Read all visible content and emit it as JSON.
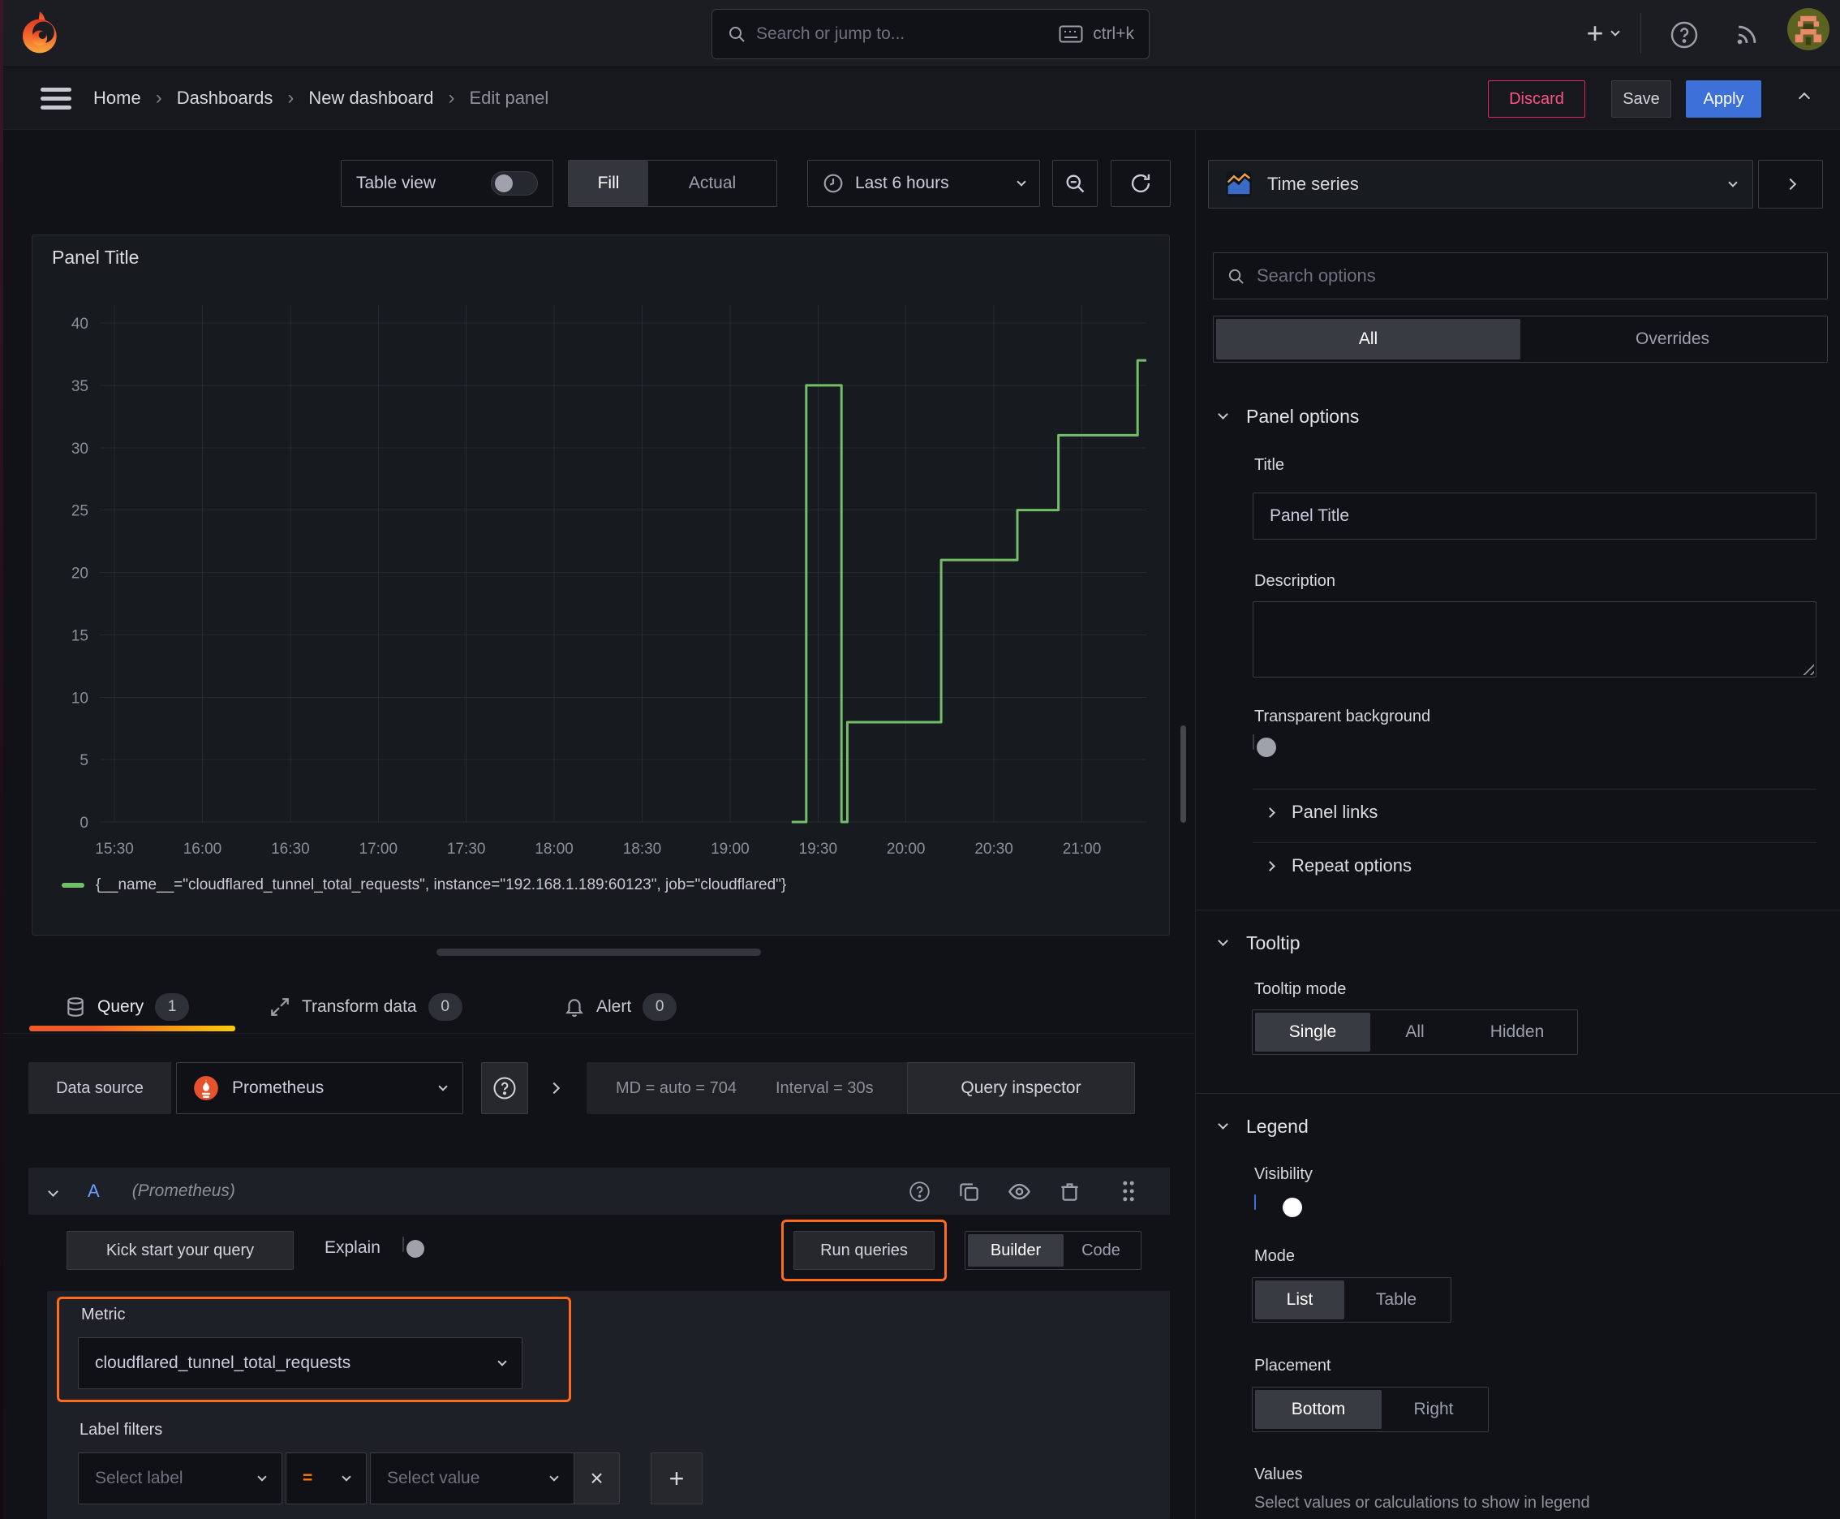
{
  "colors": {
    "accent_orange": "#ff6b18",
    "series_green": "#73bf69",
    "primary_blue": "#3d71d9",
    "danger_pink": "#ff5286"
  },
  "topbar": {
    "search_placeholder": "Search or jump to...",
    "shortcut": "ctrl+k"
  },
  "breadcrumb": {
    "items": [
      "Home",
      "Dashboards",
      "New dashboard",
      "Edit panel"
    ]
  },
  "actions": {
    "discard": "Discard",
    "save": "Save",
    "apply": "Apply"
  },
  "toolbar": {
    "table_view_label": "Table view",
    "fill": "Fill",
    "actual": "Actual",
    "time_range": "Last 6 hours"
  },
  "viz_picker": {
    "name": "Time series"
  },
  "panel": {
    "title": "Panel Title",
    "legend": "{__name__=\"cloudflared_tunnel_total_requests\", instance=\"192.168.1.189:60123\", job=\"cloudflared\"}"
  },
  "chart_data": {
    "type": "line",
    "title": "Panel Title",
    "line_interpolation": "step-after",
    "grid": true,
    "legend_position": "bottom",
    "x_domain": [
      "15:25",
      "21:22"
    ],
    "x_ticks": [
      "15:30",
      "16:00",
      "16:30",
      "17:00",
      "17:30",
      "18:00",
      "18:30",
      "19:00",
      "19:30",
      "20:00",
      "20:30",
      "21:00"
    ],
    "y_ticks": [
      0,
      5,
      10,
      15,
      20,
      25,
      30,
      35,
      40
    ],
    "ylim": [
      0,
      40
    ],
    "series": [
      {
        "name": "{__name__=\"cloudflared_tunnel_total_requests\", instance=\"192.168.1.189:60123\", job=\"cloudflared\"}",
        "color": "#73bf69",
        "step_points_time_value": [
          [
            "19:21",
            0
          ],
          [
            "19:26",
            0
          ],
          [
            "19:26",
            35
          ],
          [
            "19:38",
            35
          ],
          [
            "19:38",
            0
          ],
          [
            "19:40",
            0
          ],
          [
            "19:40",
            8
          ],
          [
            "20:12",
            8
          ],
          [
            "20:12",
            21
          ],
          [
            "20:38",
            21
          ],
          [
            "20:38",
            25
          ],
          [
            "20:52",
            25
          ],
          [
            "20:52",
            31
          ],
          [
            "21:19",
            31
          ],
          [
            "21:19",
            37
          ],
          [
            "21:22",
            37
          ]
        ]
      }
    ]
  },
  "tabs": {
    "query": "Query",
    "query_badge": "1",
    "transform": "Transform data",
    "transform_badge": "0",
    "alert": "Alert",
    "alert_badge": "0"
  },
  "datasource_row": {
    "label": "Data source",
    "value": "Prometheus",
    "stats": "MD = auto = 704",
    "interval": "Interval = 30s",
    "inspector": "Query inspector"
  },
  "query_editor": {
    "ref_id": "A",
    "ds_hint": "(Prometheus)",
    "kickstart": "Kick start your query",
    "explain": "Explain",
    "run_queries": "Run queries",
    "builder": "Builder",
    "code": "Code",
    "metric_label": "Metric",
    "metric_value": "cloudflared_tunnel_total_requests",
    "label_filters_label": "Label filters",
    "select_label_placeholder": "Select label",
    "operator": "=",
    "select_value_placeholder": "Select value"
  },
  "options_pane": {
    "search_placeholder": "Search options",
    "tab_all": "All",
    "tab_overrides": "Overrides",
    "panel_options": {
      "header": "Panel options",
      "title_label": "Title",
      "title_value": "Panel Title",
      "description_label": "Description",
      "description_value": "",
      "transparent_label": "Transparent background"
    },
    "collapsed": {
      "panel_links": "Panel links",
      "repeat_options": "Repeat options"
    },
    "tooltip": {
      "header": "Tooltip",
      "mode_label": "Tooltip mode",
      "options": [
        "Single",
        "All",
        "Hidden"
      ],
      "selected": "Single"
    },
    "legend": {
      "header": "Legend",
      "visibility_label": "Visibility",
      "mode_label": "Mode",
      "mode_options": [
        "List",
        "Table"
      ],
      "mode_selected": "List",
      "placement_label": "Placement",
      "placement_options": [
        "Bottom",
        "Right"
      ],
      "placement_selected": "Bottom",
      "values_label": "Values",
      "values_hint": "Select values or calculations to show in legend"
    }
  }
}
